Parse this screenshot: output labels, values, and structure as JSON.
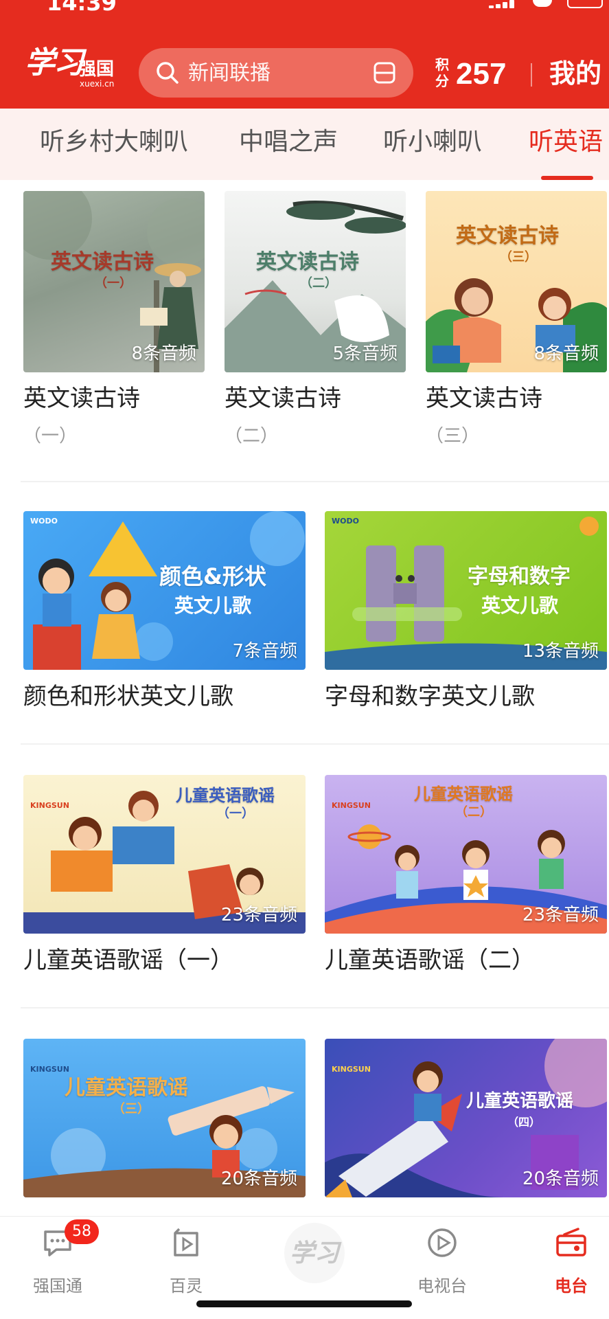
{
  "status_bar": {
    "time": "14:39"
  },
  "header": {
    "logo_glyph": "学习",
    "logo_cn": "强国",
    "logo_en": "xuexi.cn",
    "search_placeholder": "新闻联播",
    "points_label": "积分",
    "points_value": "257",
    "mine_label": "我的",
    "bg_color": "#e52c1f"
  },
  "tabs": [
    {
      "label": "听乡村大喇叭",
      "active": false
    },
    {
      "label": "中唱之声",
      "active": false
    },
    {
      "label": "听小喇叭",
      "active": false
    },
    {
      "label": "听英语",
      "active": true
    }
  ],
  "cards": [
    {
      "title": "英文读古诗",
      "subtitle": "（一）",
      "thumb_title": "英文读古诗",
      "thumb_sub": "（一）",
      "count": "8条音频",
      "icon": "poet-reading-in-rain"
    },
    {
      "title": "英文读古诗",
      "subtitle": "（二）",
      "thumb_title": "英文读古诗",
      "thumb_sub": "（二）",
      "count": "5条音频",
      "icon": "crane-and-pine"
    },
    {
      "title": "英文读古诗",
      "subtitle": "（三）",
      "thumb_title": "英文读古诗",
      "thumb_sub": "（三）",
      "count": "8条音频",
      "icon": "mother-and-child-reading"
    },
    {
      "title": "颜色和形状英文儿歌",
      "thumb_title": "颜色&形状",
      "thumb_sub": "英文儿歌",
      "count": "7条音频",
      "brand": "WODO",
      "icon": "kids-with-triangle"
    },
    {
      "title": "字母和数字英文儿歌",
      "thumb_title": "字母和数字",
      "thumb_sub": "英文儿歌",
      "count": "13条音频",
      "brand": "WODO",
      "icon": "letter-h-creature"
    },
    {
      "title": "儿童英语歌谣（一）",
      "thumb_title": "儿童英语歌谣",
      "thumb_sub": "（一）",
      "count": "23条音频",
      "brand": "KINGSUN",
      "icon": "kids-reading-books"
    },
    {
      "title": "儿童英语歌谣（二）",
      "thumb_title": "儿童英语歌谣",
      "thumb_sub": "（二）",
      "count": "23条音频",
      "brand": "KINGSUN",
      "icon": "kids-running"
    },
    {
      "title": "",
      "thumb_title": "儿童英语歌谣",
      "thumb_sub": "（三）",
      "count": "20条音频",
      "brand": "KINGSUN",
      "icon": "boy-with-pencil"
    },
    {
      "title": "",
      "thumb_title": "儿童英语歌谣",
      "thumb_sub": "（四）",
      "count": "20条音频",
      "brand": "KINGSUN",
      "icon": "boy-on-rocket"
    }
  ],
  "bottom_nav": [
    {
      "label": "强国通",
      "badge": "58",
      "icon": "chat-icon",
      "active": false
    },
    {
      "label": "百灵",
      "icon": "play-box-icon",
      "active": false
    },
    {
      "label": "",
      "icon": "xuexi-logo",
      "center_glyph": "学习",
      "active": false
    },
    {
      "label": "电视台",
      "icon": "play-circle-icon",
      "active": false
    },
    {
      "label": "电台",
      "icon": "radio-icon",
      "active": true
    }
  ]
}
